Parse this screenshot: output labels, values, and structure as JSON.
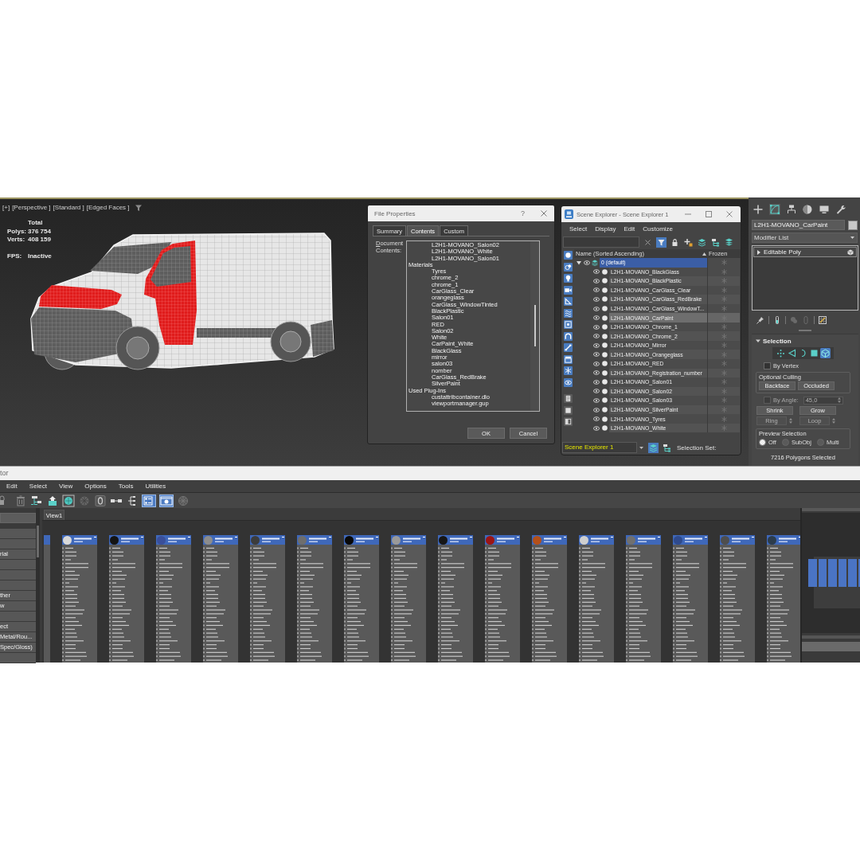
{
  "viewport": {
    "labels": [
      "[+]",
      "[Perspective ]",
      "[Standard ]",
      "[Edged Faces ]"
    ],
    "stats_heading": "Total",
    "stats": [
      {
        "label": "Polys:",
        "value": "376 754"
      },
      {
        "label": "Verts:",
        "value": "408 159"
      },
      {
        "label": "FPS:",
        "value": "Inactive"
      }
    ]
  },
  "file_properties": {
    "title": "File Properties",
    "help": "?",
    "tabs": [
      {
        "label": "Summary",
        "selected": false
      },
      {
        "label": "Contents",
        "selected": true
      },
      {
        "label": "Custom",
        "selected": false
      }
    ],
    "field_label": "Document Contents:",
    "contents": [
      {
        "children": [
          "L2H1-MOVANO_Salon02",
          "L2H1-MOVANO_White",
          "L2H1-MOVANO_Salon01"
        ]
      },
      {
        "label": "Materials",
        "children": [
          "Tyres",
          "chrome_2",
          "chrome_1",
          "CarGlass_Clear",
          "orangeglass",
          "CarGlass_WindowTinted",
          "BlackPlastic",
          "Salon01",
          "RED",
          "Salon02",
          "White",
          "CarPaint_White",
          "BlackGlass",
          "mirror",
          "salon03",
          "nomber",
          "CarGlass_RedBrake",
          "SilverPaint"
        ]
      },
      {
        "label": "Used Plug-Ins",
        "children": [
          "custattribcontainer.dlo",
          "viewportmanager.gup"
        ]
      }
    ],
    "buttons": [
      "OK",
      "Cancel"
    ]
  },
  "scene_explorer": {
    "title": "Scene Explorer - Scene Explorer 1",
    "menu": [
      "Select",
      "Display",
      "Edit",
      "Customize"
    ],
    "toolbar": [
      {
        "kind": "filter",
        "selected": true
      },
      {
        "kind": "lock",
        "selected": false
      },
      {
        "kind": "add",
        "selected": false
      },
      {
        "kind": "layers",
        "selected": false
      },
      {
        "kind": "hierarchy",
        "selected": false
      },
      {
        "kind": "stack",
        "selected": false
      }
    ],
    "side_filters": [
      {
        "kind": "geometry",
        "on": true
      },
      {
        "kind": "shape",
        "on": true
      },
      {
        "kind": "light",
        "on": true
      },
      {
        "kind": "camera",
        "on": true
      },
      {
        "kind": "helper",
        "on": true
      },
      {
        "kind": "warp",
        "on": true
      },
      {
        "kind": "group",
        "on": true
      },
      {
        "kind": "xref",
        "on": true
      },
      {
        "kind": "bone",
        "on": true
      },
      {
        "kind": "container",
        "on": true
      },
      {
        "kind": "frozen",
        "on": true
      },
      {
        "kind": "hidden",
        "on": true
      },
      {
        "kind": "all",
        "on": false
      },
      {
        "kind": "none",
        "on": false
      },
      {
        "kind": "invert",
        "on": false
      }
    ],
    "columns": [
      "Name (Sorted Ascending)",
      "Frozen"
    ],
    "layer": {
      "name": "0 (default)",
      "expanded": true,
      "selected": true,
      "objects": [
        {
          "name": "L2H1-MOVANO_BlackGlass",
          "selected": false
        },
        {
          "name": "L2H1-MOVANO_BlackPlastic",
          "selected": false
        },
        {
          "name": "L2H1-MOVANO_CarGlass_Clear",
          "selected": false
        },
        {
          "name": "L2H1-MOVANO_CarGlass_RedBrake",
          "selected": false
        },
        {
          "name": "L2H1-MOVANO_CarGlass_WindowT...",
          "selected": false
        },
        {
          "name": "L2H1-MOVANO_CarPaint",
          "selected": true
        },
        {
          "name": "L2H1-MOVANO_Chrome_1",
          "selected": false
        },
        {
          "name": "L2H1-MOVANO_Chrome_2",
          "selected": false
        },
        {
          "name": "L2H1-MOVANO_Mirror",
          "selected": false
        },
        {
          "name": "L2H1-MOVANO_Orangeglass",
          "selected": false
        },
        {
          "name": "L2H1-MOVANO_RED",
          "selected": false
        },
        {
          "name": "L2H1-MOVANO_Registration_number",
          "selected": false
        },
        {
          "name": "L2H1-MOVANO_Salon01",
          "selected": false
        },
        {
          "name": "L2H1-MOVANO_Salon02",
          "selected": false
        },
        {
          "name": "L2H1-MOVANO_Salon03",
          "selected": false
        },
        {
          "name": "L2H1-MOVANO_SilverPaint",
          "selected": false
        },
        {
          "name": "L2H1-MOVANO_Tyres",
          "selected": false
        },
        {
          "name": "L2H1-MOVANO_White",
          "selected": false
        }
      ]
    },
    "footer": {
      "explorer": "Scene Explorer 1",
      "views": [
        {
          "kind": "layers",
          "selected": true
        },
        {
          "kind": "hierarchy",
          "selected": false
        }
      ],
      "selection_set": "Selection Set:"
    }
  },
  "command_panel": {
    "tabs": [
      {
        "kind": "create",
        "selected": false
      },
      {
        "kind": "modify",
        "selected": true
      },
      {
        "kind": "hierarchy",
        "selected": false
      },
      {
        "kind": "motion",
        "selected": false
      },
      {
        "kind": "display",
        "selected": false
      },
      {
        "kind": "utilities",
        "selected": false
      }
    ],
    "object_name": "L2H1-MOVANO_CarPaint",
    "modifier_list": "Modifier List",
    "stack": [
      "Editable Poly"
    ],
    "rollout": {
      "title": "Selection",
      "expanded": true,
      "levels": [
        {
          "kind": "vertex",
          "selected": false
        },
        {
          "kind": "edge",
          "selected": false
        },
        {
          "kind": "border",
          "selected": false
        },
        {
          "kind": "polygon",
          "selected": false
        },
        {
          "kind": "element",
          "selected": true
        }
      ],
      "by_vertex": {
        "label": "By Vertex",
        "checked": false
      },
      "culling": {
        "title": "Optional Culling",
        "buttons": [
          "Backface",
          "Occluded"
        ]
      },
      "by_angle": {
        "label": "By Angle:",
        "checked": false,
        "disabled": true,
        "value": "45,0"
      },
      "buttons": [
        {
          "label": "Shrink",
          "kind": "button",
          "disabled": false
        },
        {
          "label": "Grow",
          "kind": "button",
          "disabled": false
        },
        {
          "label": "Ring",
          "kind": "spinner",
          "disabled": true
        },
        {
          "label": "Loop",
          "kind": "spinner",
          "disabled": true
        }
      ],
      "preview": {
        "title": "Preview Selection",
        "options": [
          {
            "label": "Off",
            "selected": true
          },
          {
            "label": "SubObj",
            "selected": false
          },
          {
            "label": "Multi",
            "selected": false
          }
        ]
      },
      "status": "7216 Polygons Selected"
    }
  },
  "material_editor": {
    "title": "tor",
    "menu": [
      "Edit",
      "Select",
      "View",
      "Options",
      "Tools",
      "Utilities"
    ],
    "toolbar": [
      {
        "kind": "pick",
        "selected": false
      },
      {
        "kind": "delete",
        "selected": false
      },
      {
        "kind": "layout",
        "selected": false
      },
      {
        "kind": "assign",
        "selected": false
      },
      {
        "kind": "preview",
        "selected": false
      },
      {
        "kind": "background",
        "selected": false
      },
      {
        "kind": "map",
        "selected": false
      },
      {
        "kind": "hide",
        "selected": false
      },
      {
        "kind": "tree",
        "selected": false
      },
      {
        "kind": "layout_all",
        "selected": true
      },
      {
        "kind": "navigator",
        "selected": true
      },
      {
        "kind": "select",
        "selected": false
      }
    ],
    "browser_rows": [
      null,
      null,
      "rial",
      null,
      null,
      null,
      "ther",
      "w",
      null,
      "ect",
      "Metal/Rou...",
      "Spec/Gloss)",
      null
    ],
    "tabs": [
      {
        "label": "View1",
        "selected": true
      }
    ],
    "nodes": [
      {
        "color": "#d9d9d9"
      },
      {
        "color": "#141414"
      },
      {
        "color": "#3a4f9a"
      },
      {
        "color": "#8c8c8c"
      },
      {
        "color": "#3c3c3c"
      },
      {
        "color": "#6e6e6e"
      },
      {
        "color": "#080808"
      },
      {
        "color": "#9a9a9a"
      },
      {
        "color": "#161616"
      },
      {
        "color": "#9c1414"
      },
      {
        "color": "#b4501a"
      },
      {
        "color": "#cfcfcf"
      },
      {
        "color": "#707070"
      },
      {
        "color": "#2f4a8c"
      },
      {
        "color": "#4e4e4e"
      },
      {
        "color": "#2c3c4c"
      }
    ]
  }
}
